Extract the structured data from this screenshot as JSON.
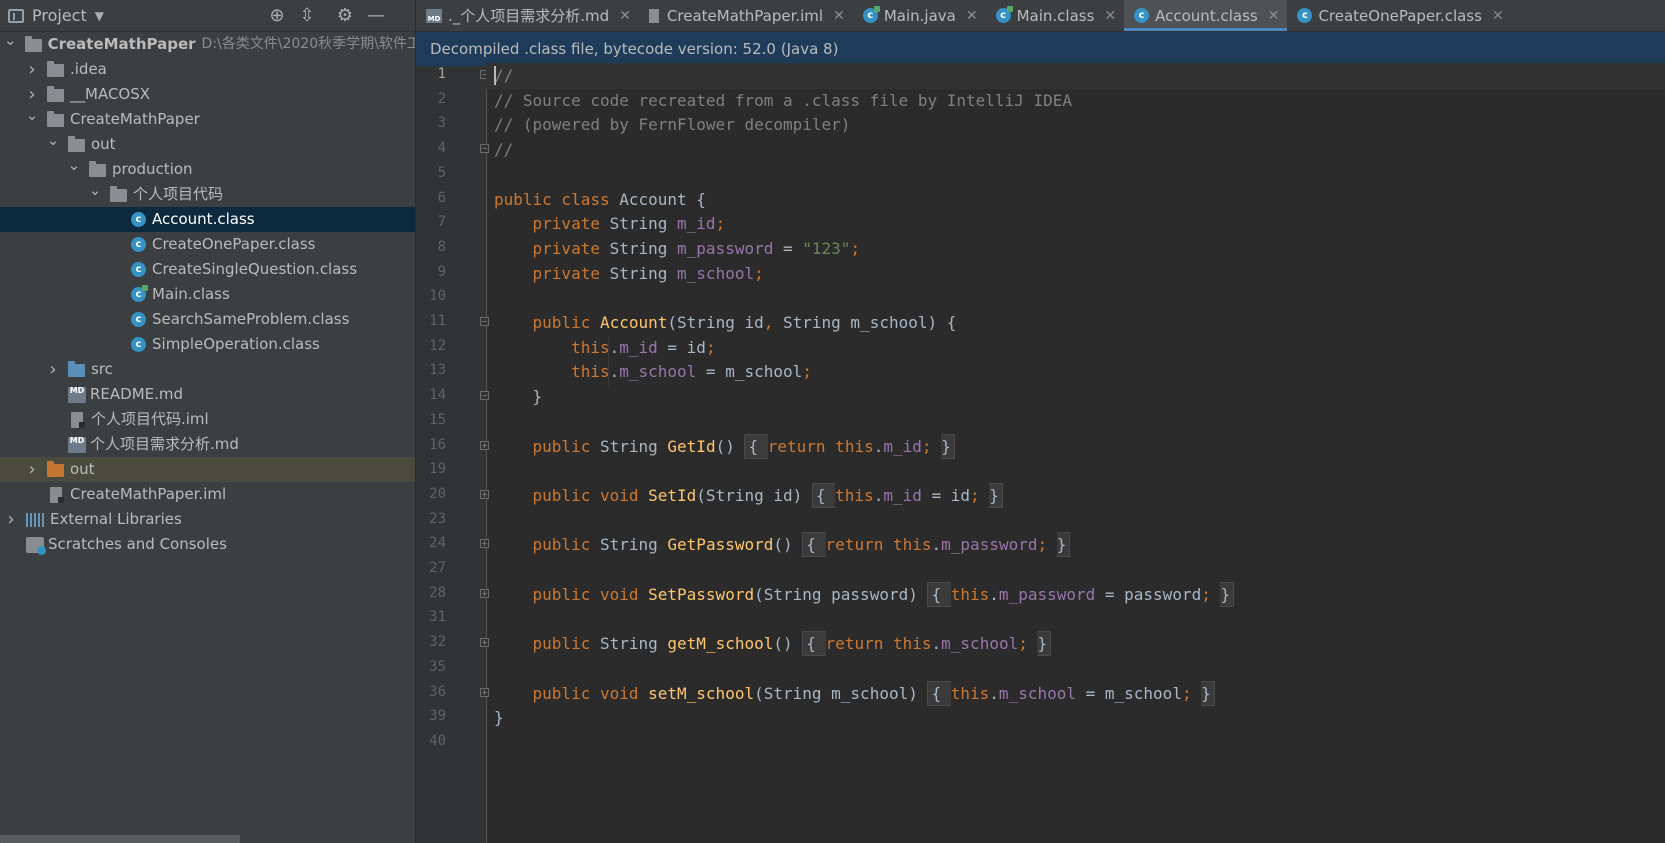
{
  "project_panel": {
    "title": "Project",
    "tree": [
      {
        "label": "CreateMathPaper",
        "path": "D:\\各类文件\\2020秋季学期\\软件工",
        "depth": 0,
        "arrow": "open",
        "icon": "module-folder-icon",
        "bold": true
      },
      {
        "label": ".idea",
        "depth": 1,
        "arrow": "closed",
        "icon": "folder-icon"
      },
      {
        "label": "__MACOSX",
        "depth": 1,
        "arrow": "closed",
        "icon": "folder-icon"
      },
      {
        "label": "CreateMathPaper",
        "depth": 1,
        "arrow": "open",
        "icon": "folder-icon"
      },
      {
        "label": "out",
        "depth": 2,
        "arrow": "open",
        "icon": "folder-icon"
      },
      {
        "label": "production",
        "depth": 3,
        "arrow": "open",
        "icon": "folder-icon"
      },
      {
        "label": "个人项目代码",
        "depth": 4,
        "arrow": "open",
        "icon": "folder-icon"
      },
      {
        "label": "Account.class",
        "depth": 5,
        "arrow": "none",
        "icon": "class-icon",
        "selected": true
      },
      {
        "label": "CreateOnePaper.class",
        "depth": 5,
        "arrow": "none",
        "icon": "class-icon"
      },
      {
        "label": "CreateSingleQuestion.class",
        "depth": 5,
        "arrow": "none",
        "icon": "class-icon"
      },
      {
        "label": "Main.class",
        "depth": 5,
        "arrow": "none",
        "icon": "runnable-class-icon"
      },
      {
        "label": "SearchSameProblem.class",
        "depth": 5,
        "arrow": "none",
        "icon": "class-icon"
      },
      {
        "label": "SimpleOperation.class",
        "depth": 5,
        "arrow": "none",
        "icon": "class-icon"
      },
      {
        "label": "src",
        "depth": 2,
        "arrow": "closed",
        "icon": "source-folder-icon"
      },
      {
        "label": "README.md",
        "depth": 2,
        "arrow": "none",
        "icon": "markdown-file-icon"
      },
      {
        "label": "个人项目代码.iml",
        "depth": 2,
        "arrow": "none",
        "icon": "iml-file-icon"
      },
      {
        "label": "个人项目需求分析.md",
        "depth": 2,
        "arrow": "none",
        "icon": "markdown-file-icon"
      },
      {
        "label": "out",
        "depth": 1,
        "arrow": "closed",
        "icon": "excluded-folder-icon",
        "highlighted": true
      },
      {
        "label": "CreateMathPaper.iml",
        "depth": 1,
        "arrow": "none",
        "icon": "iml-file-icon"
      },
      {
        "label": "External Libraries",
        "depth": 0,
        "arrow": "closed",
        "icon": "libraries-icon"
      },
      {
        "label": "Scratches and Consoles",
        "depth": 0,
        "arrow": "none",
        "icon": "scratches-icon"
      }
    ]
  },
  "tabs": [
    {
      "label": "._个人项目需求分析.md",
      "icon": "markdown-file-icon"
    },
    {
      "label": "CreateMathPaper.iml",
      "icon": "iml-file-icon"
    },
    {
      "label": "Main.java",
      "icon": "runnable-class-icon"
    },
    {
      "label": "Main.class",
      "icon": "runnable-class-icon"
    },
    {
      "label": "Account.class",
      "icon": "class-icon",
      "active": true
    },
    {
      "label": "CreateOnePaper.class",
      "icon": "class-icon"
    }
  ],
  "banner": "Decompiled .class file, bytecode version: 52.0 (Java 8)",
  "editor": {
    "line_numbers": [
      "1",
      "2",
      "3",
      "4",
      "5",
      "6",
      "7",
      "8",
      "9",
      "10",
      "11",
      "12",
      "13",
      "14",
      "15",
      "16",
      "19",
      "20",
      "23",
      "24",
      "27",
      "28",
      "31",
      "32",
      "35",
      "36",
      "39",
      "40"
    ],
    "lines": [
      [
        {
          "t": "//",
          "c": "c"
        }
      ],
      [
        {
          "t": "// Source code recreated from a .class file by IntelliJ IDEA",
          "c": "c"
        }
      ],
      [
        {
          "t": "// (powered by FernFlower decompiler)",
          "c": "c"
        }
      ],
      [
        {
          "t": "//",
          "c": "c"
        }
      ],
      [],
      [
        {
          "t": "public class ",
          "c": "k"
        },
        {
          "t": "Account {",
          "c": ""
        }
      ],
      [
        {
          "t": "    private ",
          "c": "k"
        },
        {
          "t": "String ",
          "c": ""
        },
        {
          "t": "m_id",
          "c": "f"
        },
        {
          "t": ";",
          "c": "k"
        }
      ],
      [
        {
          "t": "    private ",
          "c": "k"
        },
        {
          "t": "String ",
          "c": ""
        },
        {
          "t": "m_password",
          "c": "f"
        },
        {
          "t": " = ",
          "c": ""
        },
        {
          "t": "\"123\"",
          "c": "s"
        },
        {
          "t": ";",
          "c": "k"
        }
      ],
      [
        {
          "t": "    private ",
          "c": "k"
        },
        {
          "t": "String ",
          "c": ""
        },
        {
          "t": "m_school",
          "c": "f"
        },
        {
          "t": ";",
          "c": "k"
        }
      ],
      [],
      [
        {
          "t": "    public ",
          "c": "k"
        },
        {
          "t": "Account",
          "c": "m"
        },
        {
          "t": "(String id",
          "c": ""
        },
        {
          "t": ", ",
          "c": "k"
        },
        {
          "t": "String m_school) {",
          "c": ""
        }
      ],
      [
        {
          "t": "        this",
          "c": "k"
        },
        {
          "t": ".",
          "c": ""
        },
        {
          "t": "m_id",
          "c": "f"
        },
        {
          "t": " = id",
          "c": ""
        },
        {
          "t": ";",
          "c": "k"
        }
      ],
      [
        {
          "t": "        this",
          "c": "k"
        },
        {
          "t": ".",
          "c": ""
        },
        {
          "t": "m_school",
          "c": "f"
        },
        {
          "t": " = m_school",
          "c": ""
        },
        {
          "t": ";",
          "c": "k"
        }
      ],
      [
        {
          "t": "    }",
          "c": ""
        }
      ],
      [],
      [
        {
          "t": "    public ",
          "c": "k"
        },
        {
          "t": "String ",
          "c": ""
        },
        {
          "t": "GetId",
          "c": "m"
        },
        {
          "t": "() ",
          "c": ""
        },
        {
          "t": "{ ",
          "c": "fbo"
        },
        {
          "t": "return this",
          "c": "k"
        },
        {
          "t": ".",
          "c": ""
        },
        {
          "t": "m_id",
          "c": "f"
        },
        {
          "t": "; ",
          "c": "k"
        },
        {
          "t": "}",
          "c": "fbc"
        }
      ],
      [],
      [
        {
          "t": "    public void ",
          "c": "k"
        },
        {
          "t": "SetId",
          "c": "m"
        },
        {
          "t": "(String id) ",
          "c": ""
        },
        {
          "t": "{ ",
          "c": "fbo"
        },
        {
          "t": "this",
          "c": "k"
        },
        {
          "t": ".",
          "c": ""
        },
        {
          "t": "m_id",
          "c": "f"
        },
        {
          "t": " = id",
          "c": ""
        },
        {
          "t": "; ",
          "c": "k"
        },
        {
          "t": "}",
          "c": "fbc"
        }
      ],
      [],
      [
        {
          "t": "    public ",
          "c": "k"
        },
        {
          "t": "String ",
          "c": ""
        },
        {
          "t": "GetPassword",
          "c": "m"
        },
        {
          "t": "() ",
          "c": ""
        },
        {
          "t": "{ ",
          "c": "fbo"
        },
        {
          "t": "return this",
          "c": "k"
        },
        {
          "t": ".",
          "c": ""
        },
        {
          "t": "m_password",
          "c": "f"
        },
        {
          "t": "; ",
          "c": "k"
        },
        {
          "t": "}",
          "c": "fbc"
        }
      ],
      [],
      [
        {
          "t": "    public void ",
          "c": "k"
        },
        {
          "t": "SetPassword",
          "c": "m"
        },
        {
          "t": "(String password) ",
          "c": ""
        },
        {
          "t": "{ ",
          "c": "fbo"
        },
        {
          "t": "this",
          "c": "k"
        },
        {
          "t": ".",
          "c": ""
        },
        {
          "t": "m_password",
          "c": "f"
        },
        {
          "t": " = password",
          "c": ""
        },
        {
          "t": "; ",
          "c": "k"
        },
        {
          "t": "}",
          "c": "fbc"
        }
      ],
      [],
      [
        {
          "t": "    public ",
          "c": "k"
        },
        {
          "t": "String ",
          "c": ""
        },
        {
          "t": "getM_school",
          "c": "m"
        },
        {
          "t": "() ",
          "c": ""
        },
        {
          "t": "{ ",
          "c": "fbo"
        },
        {
          "t": "return this",
          "c": "k"
        },
        {
          "t": ".",
          "c": ""
        },
        {
          "t": "m_school",
          "c": "f"
        },
        {
          "t": "; ",
          "c": "k"
        },
        {
          "t": "}",
          "c": "fbc"
        }
      ],
      [],
      [
        {
          "t": "    public void ",
          "c": "k"
        },
        {
          "t": "setM_school",
          "c": "m"
        },
        {
          "t": "(String m_school) ",
          "c": ""
        },
        {
          "t": "{ ",
          "c": "fbo"
        },
        {
          "t": "this",
          "c": "k"
        },
        {
          "t": ".",
          "c": ""
        },
        {
          "t": "m_school",
          "c": "f"
        },
        {
          "t": " = m_school",
          "c": ""
        },
        {
          "t": "; ",
          "c": "k"
        },
        {
          "t": "}",
          "c": "fbc"
        }
      ],
      [
        {
          "t": "}",
          "c": ""
        }
      ],
      []
    ]
  },
  "colors": {
    "accent": "#4a88c7",
    "selection": "#0d293e",
    "keyword": "#cc7832",
    "field": "#9876aa",
    "string": "#6a8759",
    "method": "#ffc66d",
    "comment": "#808080"
  }
}
